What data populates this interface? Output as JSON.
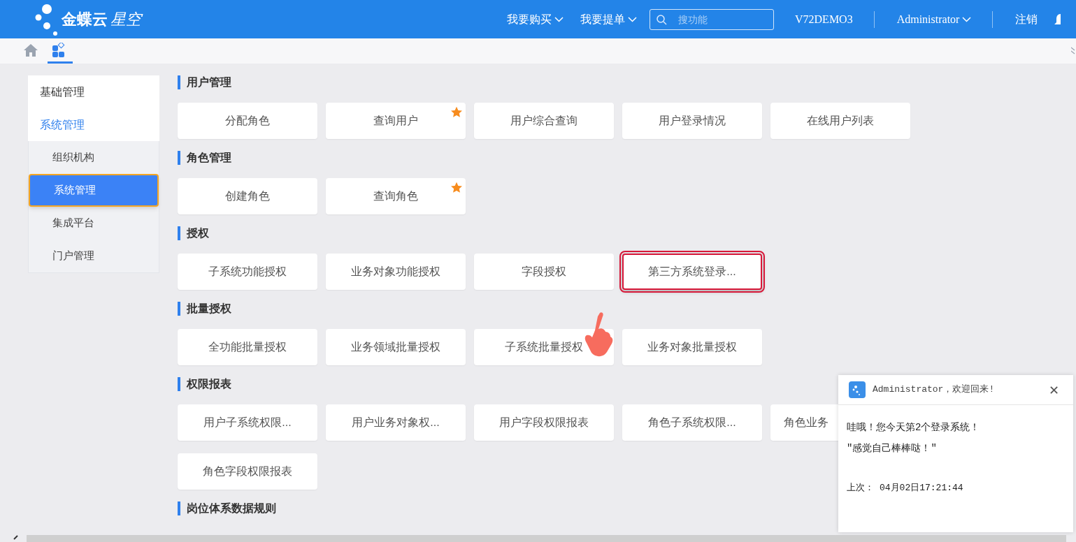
{
  "header": {
    "logo_bold": "金蝶云",
    "logo_light": "星空",
    "menus": [
      {
        "label": "我要购买"
      },
      {
        "label": "我要提单"
      }
    ],
    "search": {
      "placeholder": "搜功能"
    },
    "tenant": "V72DEMO3",
    "user": "Administrator",
    "logout": "注销"
  },
  "tabs": [
    {
      "kind": "home",
      "selected": false
    },
    {
      "kind": "apps",
      "selected": true
    }
  ],
  "sidebar": {
    "items": [
      {
        "label": "基础管理",
        "selected": false
      },
      {
        "label": "系统管理",
        "selected": true,
        "expanded": true,
        "children": [
          {
            "label": "组织机构",
            "selected": false
          },
          {
            "label": "系统管理",
            "selected": true
          },
          {
            "label": "集成平台",
            "selected": false
          },
          {
            "label": "门户管理",
            "selected": false
          }
        ]
      }
    ]
  },
  "sections": [
    {
      "title": "用户管理",
      "tiles": [
        {
          "label": "分配角色",
          "starred": false,
          "highlighted": false
        },
        {
          "label": "查询用户",
          "starred": true,
          "highlighted": false
        },
        {
          "label": "用户综合查询",
          "starred": false,
          "highlighted": false
        },
        {
          "label": "用户登录情况",
          "starred": false,
          "highlighted": false
        },
        {
          "label": "在线用户列表",
          "starred": false,
          "highlighted": false
        }
      ]
    },
    {
      "title": "角色管理",
      "tiles": [
        {
          "label": "创建角色",
          "starred": false,
          "highlighted": false
        },
        {
          "label": "查询角色",
          "starred": true,
          "highlighted": false
        }
      ]
    },
    {
      "title": "授权",
      "tiles": [
        {
          "label": "子系统功能授权",
          "starred": false,
          "highlighted": false
        },
        {
          "label": "业务对象功能授权",
          "starred": false,
          "highlighted": false
        },
        {
          "label": "字段授权",
          "starred": false,
          "highlighted": false
        },
        {
          "label": "第三方系统登录...",
          "starred": false,
          "highlighted": true
        }
      ]
    },
    {
      "title": "批量授权",
      "tiles": [
        {
          "label": "全功能批量授权",
          "starred": false,
          "highlighted": false
        },
        {
          "label": "业务领域批量授权",
          "starred": false,
          "highlighted": false
        },
        {
          "label": "子系统批量授权",
          "starred": false,
          "highlighted": false
        },
        {
          "label": "业务对象批量授权",
          "starred": false,
          "highlighted": false
        }
      ]
    },
    {
      "title": "权限报表",
      "tiles": [
        {
          "label": "用户子系统权限...",
          "starred": false,
          "highlighted": false
        },
        {
          "label": "用户业务对象权...",
          "starred": false,
          "highlighted": false
        },
        {
          "label": "用户字段权限报表",
          "starred": false,
          "highlighted": false
        },
        {
          "label": "角色子系统权限...",
          "starred": false,
          "highlighted": false
        },
        {
          "label": "角色业务",
          "starred": false,
          "highlighted": false,
          "kind": "clipped"
        },
        {
          "label": "角色字段权限报表",
          "starred": false,
          "highlighted": false
        }
      ]
    },
    {
      "title": "岗位体系数据规则"
    }
  ],
  "notification": {
    "title": "Administrator，欢迎回来!",
    "lines": [
      "哇哦！您今天第2个登录系统！",
      "″感觉自己棒棒哒！″"
    ],
    "last_login_label": "上次：",
    "last_login": "04月02日17:21:44",
    "close": "✕"
  }
}
